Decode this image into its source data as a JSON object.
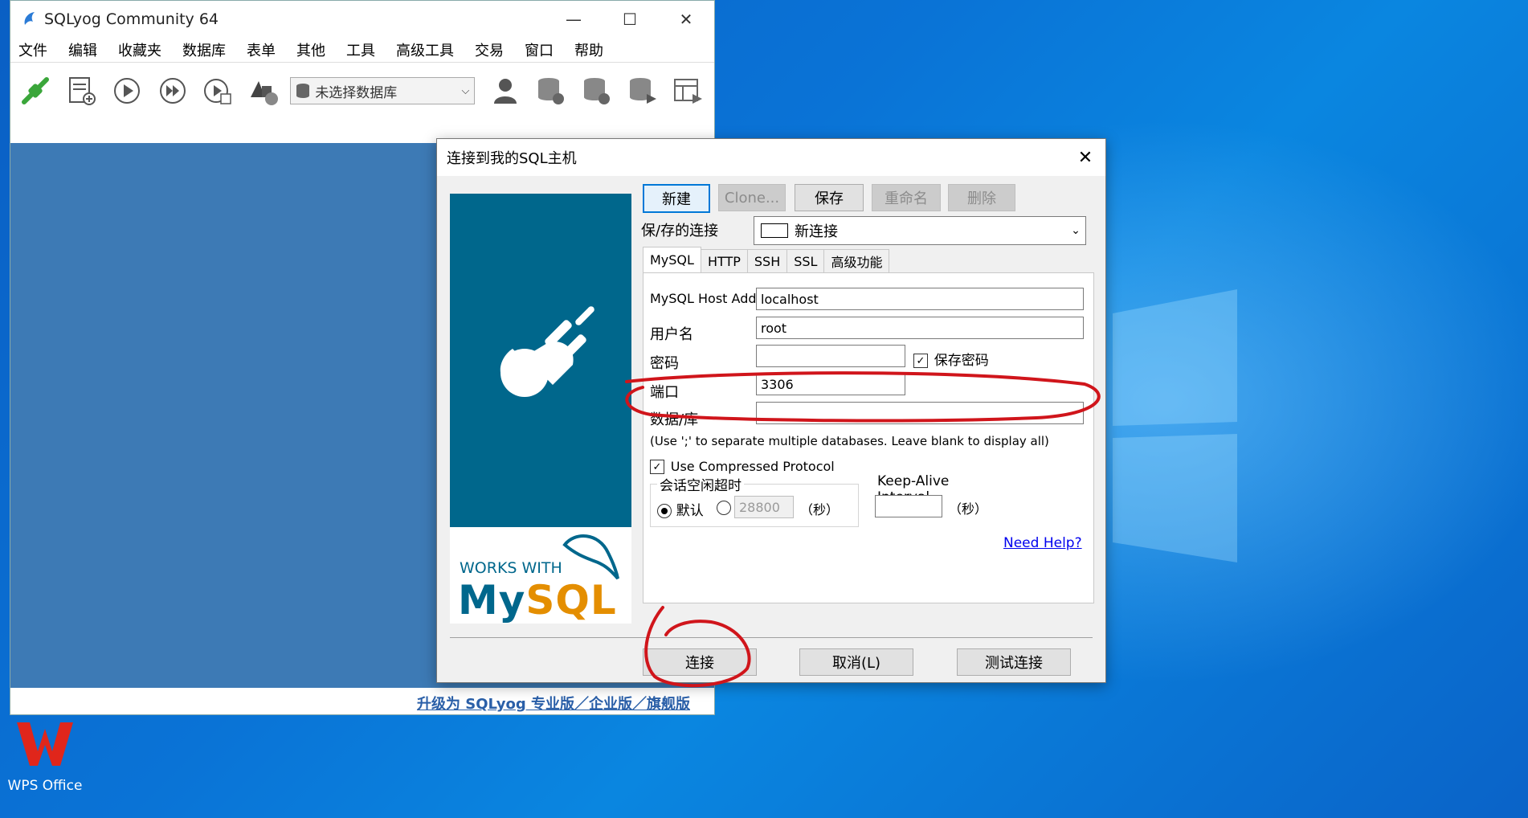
{
  "desktop": {
    "wps_label": "WPS Office"
  },
  "main_window": {
    "title": "SQLyog Community 64",
    "menu": [
      "文件",
      "编辑",
      "收藏夹",
      "数据库",
      "表单",
      "其他",
      "工具",
      "高级工具",
      "交易",
      "窗口",
      "帮助"
    ],
    "db_selector": "未选择数据库",
    "upgrade_link": "升级为 SQLyog 专业版／企业版／旗舰版"
  },
  "dialog": {
    "title": "连接到我的SQL主机",
    "buttons": {
      "new": "新建",
      "clone": "Clone...",
      "save": "保存",
      "rename": "重命名",
      "delete": "删除"
    },
    "saved_connection_label": "保/存的连接",
    "saved_connection_value": "新连接",
    "tabs": [
      "MySQL",
      "HTTP",
      "SSH",
      "SSL",
      "高级功能"
    ],
    "fields": {
      "host_label": "MySQL Host Address",
      "host_value": "localhost",
      "user_label": "用户名",
      "user_value": "root",
      "password_label": "密码",
      "password_value": "",
      "save_password_label": "保存密码",
      "port_label": "端口",
      "port_value": "3306",
      "database_label": "数据/库",
      "database_value": ""
    },
    "hint": "(Use ';' to separate multiple databases. Leave blank to display all)",
    "compressed_label": "Use Compressed Protocol",
    "session_group_title": "会话空闲超时",
    "default_label": "默认",
    "timeout_value": "28800",
    "seconds_label": "（秒）",
    "keepalive_title": "Keep-Alive Interval",
    "keepalive_value": "",
    "need_help": "Need Help?",
    "works_with": "WORKS WITH",
    "mysql_logo_my": "My",
    "mysql_logo_sql": "SQL",
    "footer": {
      "connect": "连接",
      "cancel": "取消(L)",
      "test": "测试连接"
    }
  },
  "colors": {
    "annotation": "#d0151b",
    "banner": "#00678c",
    "workspace": "#3d7ab5"
  }
}
